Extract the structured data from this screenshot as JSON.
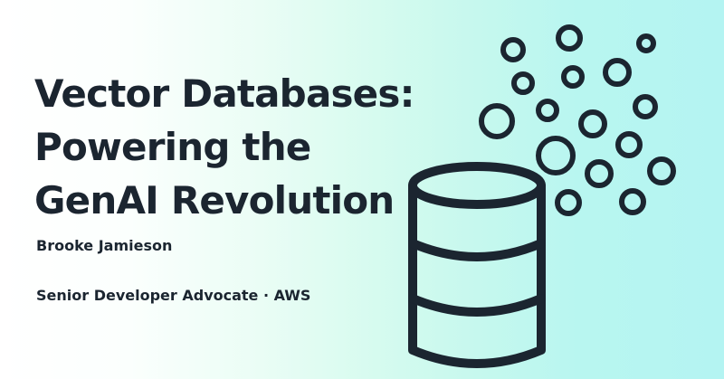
{
  "slide": {
    "title_lines": [
      "Vector Databases:",
      "Powering the",
      "GenAI Revolution"
    ],
    "author": "Brooke Jamieson",
    "role": "Senior Developer Advocate · AWS"
  },
  "colors": {
    "text": "#1b2530",
    "icon_stroke": "#1b2530",
    "background_left": "#ffffff",
    "background_right": "#b4f4f2"
  },
  "icons": [
    "database-icon",
    "vector-embedding-circles-icon"
  ]
}
